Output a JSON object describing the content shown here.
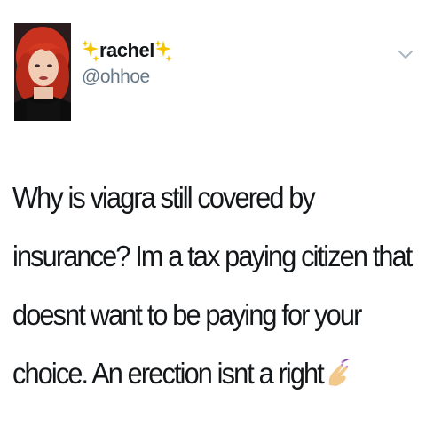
{
  "tweet": {
    "display_name_decoration": "✨",
    "display_name": "rachel",
    "handle": "@ohhoe",
    "text_lines": [
      "Why is viagra still covered by",
      "insurance? Im a tax paying citizen that",
      "doesnt want to be paying for your",
      "choice. An erection isnt a right"
    ],
    "trailing_emoji": "nail-polish-icon"
  },
  "colors": {
    "text": "#14171a",
    "handle": "#657786",
    "chevron": "#aab8c2",
    "sparkle": "#f5c400",
    "nail_polish": "#c58bd8"
  }
}
